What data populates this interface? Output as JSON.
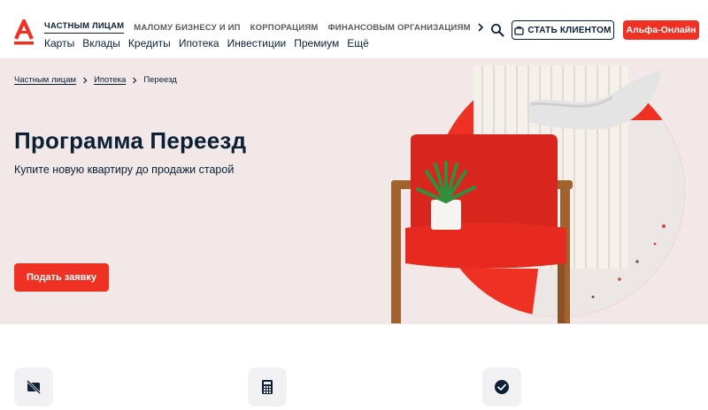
{
  "header": {
    "segments": [
      "ЧАСТНЫМ ЛИЦАМ",
      "МАЛОМУ БИЗНЕСУ И ИП",
      "КОРПОРАЦИЯМ",
      "ФИНАНСОВЫМ ОРГАНИЗАЦИЯМ"
    ],
    "main_nav": [
      "Карты",
      "Вклады",
      "Кредиты",
      "Ипотека",
      "Инвестиции",
      "Премиум",
      "Ещё"
    ],
    "become_client_label": "СТАТЬ КЛИЕНТОМ",
    "online_label": "Альфа-Онлайн"
  },
  "breadcrumb": [
    "Частным лицам",
    "Ипотека",
    "Переезд"
  ],
  "hero": {
    "title": "Программа Переезд",
    "subtitle": "Купите новую квартиру до продажи старой",
    "apply_label": "Подать заявку"
  },
  "features": [
    {
      "icon": "no-card-icon"
    },
    {
      "icon": "calculator-icon"
    },
    {
      "icon": "check-circle-icon"
    }
  ],
  "colors": {
    "brand_red": "#ef3124",
    "text_dark": "#0b1f35",
    "hero_bg": "#f2e8e7",
    "feature_icon_bg": "#f1f1f3"
  }
}
